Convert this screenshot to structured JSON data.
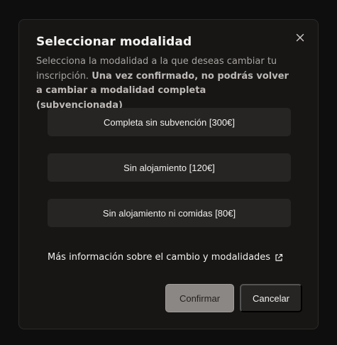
{
  "modal": {
    "title": "Seleccionar modalidad",
    "description_plain": "Selecciona la modalidad a la que deseas cambiar tu inscripción. ",
    "description_bold": "Una vez confirmado, no podrás volver a cambiar a modalidad completa (subvencionada)",
    "close_icon": "close-icon"
  },
  "options": [
    {
      "label": "Completa sin subvención [300€]"
    },
    {
      "label": "Sin alojamiento [120€]"
    },
    {
      "label": "Sin alojamiento ni comidas [80€]"
    }
  ],
  "more_info": {
    "label": "Más información sobre el cambio y modalidades",
    "icon": "external-link-icon"
  },
  "actions": {
    "confirm_label": "Confirmar",
    "cancel_label": "Cancelar"
  },
  "colors": {
    "background": "#0f0e0e",
    "modal_bg": "#171615",
    "option_bg": "#272523",
    "confirm_bg": "#8b8784"
  }
}
